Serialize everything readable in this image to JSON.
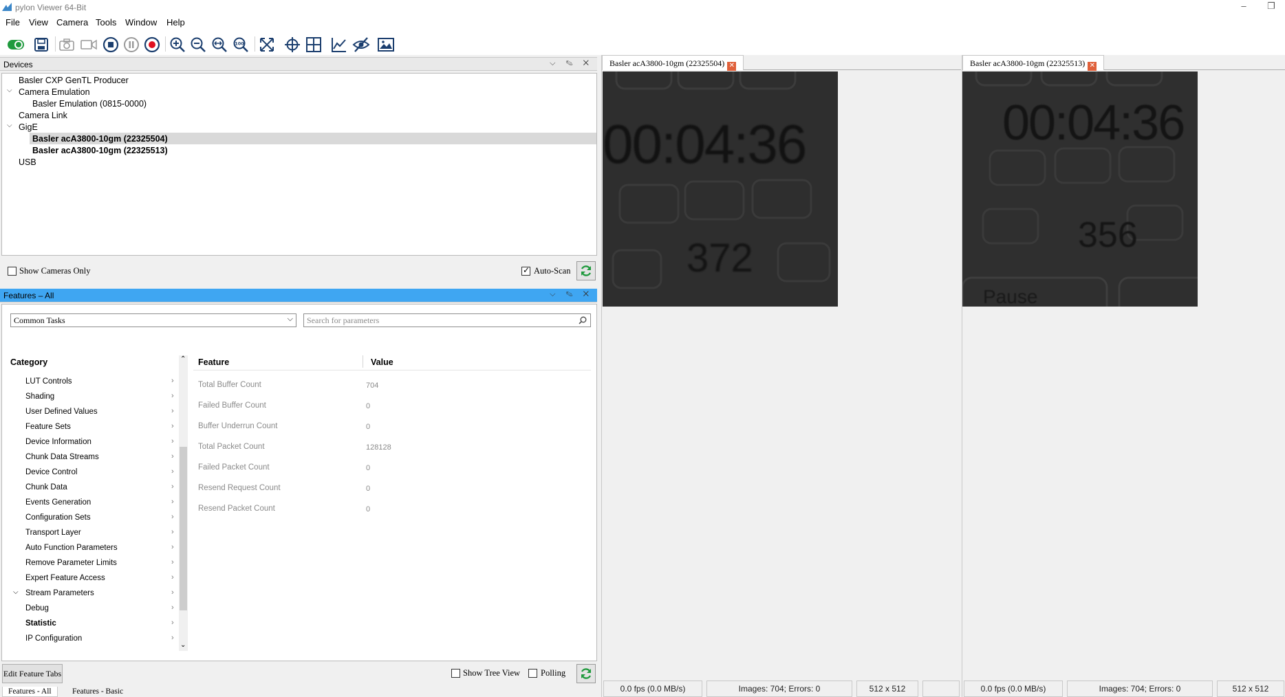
{
  "app": {
    "title": "pylon Viewer 64-Bit"
  },
  "menu": [
    "File",
    "View",
    "Camera",
    "Tools",
    "Window",
    "Help"
  ],
  "toolbar_icons": [
    "toggle-icon",
    "save-icon",
    "camera-icon",
    "video-icon",
    "stop-icon",
    "pause-icon",
    "record-icon",
    "zoom-in-icon",
    "zoom-out-icon",
    "zoom-fit-icon",
    "zoom-100-icon",
    "fullscreen-icon",
    "crosshair-icon",
    "grid-icon",
    "histogram-icon",
    "hide-icon",
    "image-icon"
  ],
  "devices": {
    "title": "Devices",
    "tree": [
      {
        "label": "Basler CXP GenTL Producer"
      },
      {
        "label": "Camera Emulation"
      },
      {
        "label": "Basler Emulation (0815-0000)"
      },
      {
        "label": "Camera Link"
      },
      {
        "label": "GigE"
      },
      {
        "label": "Basler acA3800-10gm (22325504)"
      },
      {
        "label": "Basler acA3800-10gm (22325513)"
      },
      {
        "label": "USB"
      }
    ],
    "show_cameras_only": "Show Cameras Only",
    "auto_scan": "Auto-Scan"
  },
  "features": {
    "title": "Features – All",
    "dropdown_value": "Common Tasks",
    "search_placeholder": "Search for parameters",
    "category_header": "Category",
    "feature_header": "Feature",
    "value_header": "Value",
    "categories": [
      "LUT Controls",
      "Shading",
      "User Defined Values",
      "Feature Sets",
      "Device Information",
      "Chunk Data Streams",
      "Device Control",
      "Chunk Data",
      "Events Generation",
      "Configuration Sets",
      "Transport Layer",
      "Auto Function Parameters",
      "Remove Parameter Limits",
      "Expert Feature Access",
      "Stream Parameters",
      "Debug",
      "Statistic",
      "IP Configuration"
    ],
    "rows": [
      {
        "feature": "Total Buffer Count",
        "value": "704"
      },
      {
        "feature": "Failed Buffer Count",
        "value": "0"
      },
      {
        "feature": "Buffer Underrun Count",
        "value": "0"
      },
      {
        "feature": "Total Packet Count",
        "value": "128128"
      },
      {
        "feature": "Failed Packet Count",
        "value": "0"
      },
      {
        "feature": "Resend Request Count",
        "value": "0"
      },
      {
        "feature": "Resend Packet Count",
        "value": "0"
      }
    ],
    "edit_tabs_label": "Edit Feature Tabs",
    "show_tree_view": "Show Tree View",
    "polling": "Polling",
    "bottom_tabs": [
      "Features - All",
      "Features - Basic"
    ]
  },
  "cameras": [
    {
      "tab": "Basler acA3800-10gm (22325504)",
      "time": "00:04:36",
      "count": "372",
      "fps": "0.0 fps (0.0 MB/s)",
      "images": "Images: 704; Errors: 0",
      "size": "512 x 512"
    },
    {
      "tab": "Basler acA3800-10gm (22325513)",
      "time": "00:04:36",
      "count": "356",
      "pause": "Pause",
      "fps": "0.0 fps (0.0 MB/s)",
      "images": "Images: 704; Errors: 0",
      "size": "512 x 512"
    }
  ]
}
